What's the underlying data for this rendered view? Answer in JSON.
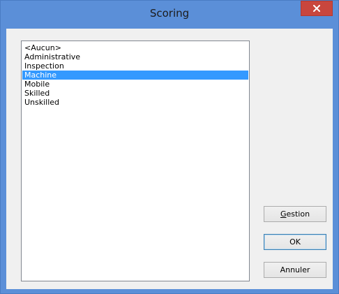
{
  "window": {
    "title": "Scoring",
    "close_glyph": "×",
    "close_icon": "close-icon"
  },
  "list": {
    "items": [
      {
        "label": "<Aucun>",
        "selected": false
      },
      {
        "label": "Administrative",
        "selected": false
      },
      {
        "label": "Inspection",
        "selected": false
      },
      {
        "label": "Machine",
        "selected": true
      },
      {
        "label": "Mobile",
        "selected": false
      },
      {
        "label": "Skilled",
        "selected": false
      },
      {
        "label": "Unskilled",
        "selected": false
      }
    ]
  },
  "buttons": {
    "gestion_first": "G",
    "gestion_rest": "estion",
    "ok": "OK",
    "annuler": "Annuler"
  },
  "colors": {
    "frame": "#5b8fd8",
    "close_button": "#c9463d",
    "selection": "#3399ff",
    "dialog_bg": "#f0f0f0"
  }
}
